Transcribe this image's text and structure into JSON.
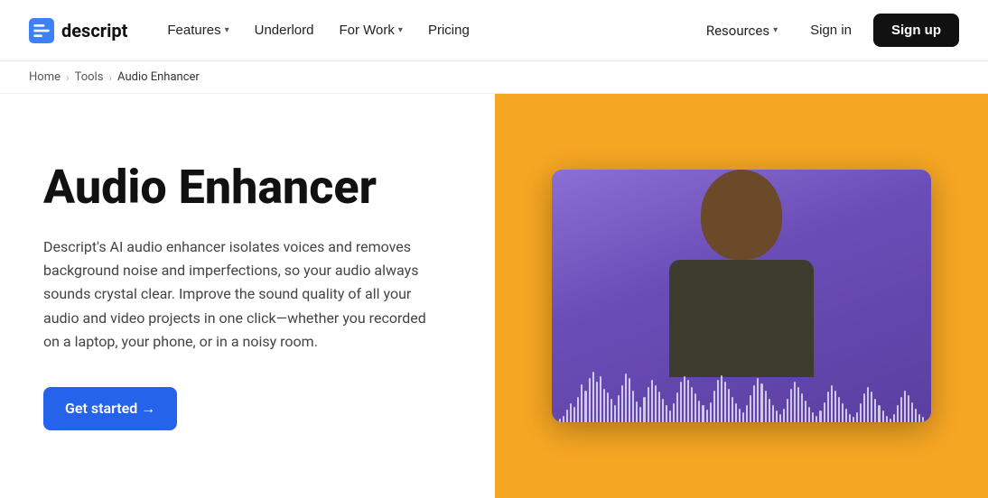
{
  "nav": {
    "logo_text": "descript",
    "links": [
      {
        "label": "Features",
        "has_chevron": true
      },
      {
        "label": "Underlord",
        "has_chevron": false
      },
      {
        "label": "For Work",
        "has_chevron": true
      },
      {
        "label": "Pricing",
        "has_chevron": false
      }
    ],
    "resources_label": "Resources",
    "signin_label": "Sign in",
    "signup_label": "Sign up"
  },
  "breadcrumb": {
    "home": "Home",
    "tools": "Tools",
    "current": "Audio Enhancer"
  },
  "hero": {
    "title": "Audio Enhancer",
    "description": "Descript's AI audio enhancer isolates voices and removes background noise and imperfections, so your audio always sounds crystal clear. Improve the sound quality of all your audio and video projects in one click—whether you recorded on a laptop, your phone, or in a noisy room.",
    "cta_label": "Get started →",
    "background_color": "#f5a623",
    "video_bg_color": "#7c5cbf"
  },
  "waveform_bars": [
    3,
    8,
    15,
    22,
    18,
    30,
    45,
    38,
    52,
    60,
    48,
    55,
    40,
    35,
    28,
    20,
    32,
    44,
    58,
    52,
    38,
    25,
    18,
    30,
    42,
    50,
    44,
    36,
    28,
    20,
    14,
    22,
    35,
    48,
    55,
    50,
    42,
    34,
    26,
    20,
    15,
    24,
    38,
    50,
    56,
    48,
    40,
    30,
    22,
    16,
    12,
    20,
    32,
    44,
    52,
    46,
    38,
    28,
    20,
    14,
    10,
    16,
    28,
    40,
    48,
    42,
    34,
    26,
    18,
    12,
    8,
    14,
    24,
    36,
    44,
    38,
    30,
    22,
    16,
    10,
    6,
    12,
    22,
    34,
    42,
    36,
    28,
    20,
    14,
    8,
    4,
    10,
    20,
    30,
    38,
    32,
    24,
    16,
    10,
    6
  ]
}
